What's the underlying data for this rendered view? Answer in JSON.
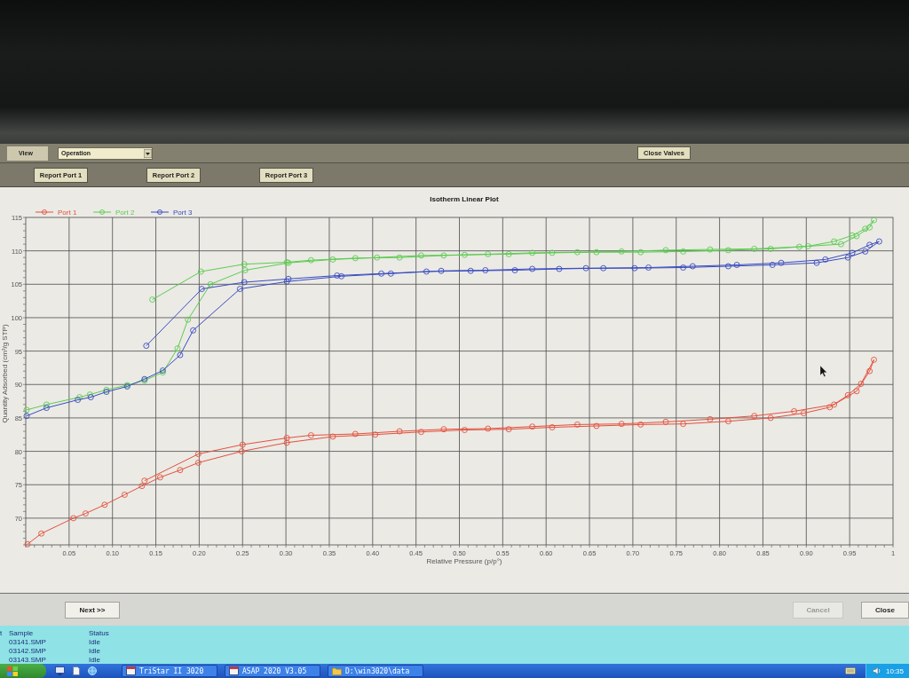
{
  "toolbar": {
    "view_label": "View",
    "view_select": {
      "value": "Operation"
    },
    "close_valves_button": "Close Valves"
  },
  "report_buttons": [
    "Report Port 1",
    "Report Port 2",
    "Report Port 3"
  ],
  "plot": {
    "chart_data": {
      "type": "line",
      "title": "Isotherm Linear Plot",
      "xlabel": "Relative Pressure (p/p°)",
      "ylabel": "Quantity Adsorbed (cm³/g STP)",
      "xlim": [
        0,
        1
      ],
      "ylim": [
        66,
        115
      ],
      "grid": true,
      "legend": "top",
      "xticks": [
        {
          "value": 0.05,
          "label": "0.05"
        },
        {
          "value": 0.1,
          "label": "0.10"
        },
        {
          "value": 0.15,
          "label": "0.15"
        },
        {
          "value": 0.2,
          "label": "0.20"
        },
        {
          "value": 0.25,
          "label": "0.25"
        },
        {
          "value": 0.3,
          "label": "0.30"
        },
        {
          "value": 0.35,
          "label": "0.35"
        },
        {
          "value": 0.4,
          "label": "0.40"
        },
        {
          "value": 0.45,
          "label": "0.45"
        },
        {
          "value": 0.5,
          "label": "0.50"
        },
        {
          "value": 0.55,
          "label": "0.55"
        },
        {
          "value": 0.6,
          "label": "0.60"
        },
        {
          "value": 0.65,
          "label": "0.65"
        },
        {
          "value": 0.7,
          "label": "0.70"
        },
        {
          "value": 0.75,
          "label": "0.75"
        },
        {
          "value": 0.8,
          "label": "0.80"
        },
        {
          "value": 0.85,
          "label": "0.85"
        },
        {
          "value": 0.9,
          "label": "0.90"
        },
        {
          "value": 0.95,
          "label": "0.95"
        },
        {
          "value": 1,
          "label": "1"
        }
      ],
      "yticks": [
        70,
        75,
        80,
        85,
        90,
        95,
        100,
        105,
        110,
        115
      ],
      "series": [
        {
          "name": "Port 1",
          "color": "#e4503c",
          "marker": "circle",
          "x": [
            0.002,
            0.018,
            0.055,
            0.069,
            0.091,
            0.114,
            0.134,
            0.155,
            0.178,
            0.199,
            0.249,
            0.301,
            0.354,
            0.403,
            0.456,
            0.506,
            0.557,
            0.607,
            0.658,
            0.709,
            0.758,
            0.81,
            0.859,
            0.897,
            0.927,
            0.948,
            0.963,
            0.978,
            0.973,
            0.958,
            0.932,
            0.886,
            0.84,
            0.789,
            0.738,
            0.687,
            0.636,
            0.584,
            0.533,
            0.482,
            0.431,
            0.38,
            0.329,
            0.301,
            0.25,
            0.199,
            0.137
          ],
          "values": [
            66.1,
            67.7,
            70.0,
            70.7,
            72.0,
            73.5,
            74.8,
            76.1,
            77.2,
            78.3,
            80.0,
            81.3,
            82.2,
            82.5,
            82.9,
            83.2,
            83.3,
            83.6,
            83.8,
            84.0,
            84.1,
            84.5,
            85.0,
            85.7,
            86.6,
            88.4,
            90.1,
            93.7,
            92.0,
            89.0,
            87.0,
            86.0,
            85.3,
            84.8,
            84.4,
            84.1,
            84.0,
            83.7,
            83.4,
            83.3,
            83.0,
            82.6,
            82.4,
            82.0,
            81.0,
            79.6,
            75.6
          ]
        },
        {
          "name": "Port 2",
          "color": "#5ccc50",
          "marker": "circle",
          "x": [
            0.001,
            0.024,
            0.062,
            0.074,
            0.093,
            0.117,
            0.137,
            0.158,
            0.175,
            0.187,
            0.213,
            0.253,
            0.303,
            0.354,
            0.405,
            0.456,
            0.506,
            0.557,
            0.607,
            0.658,
            0.709,
            0.758,
            0.81,
            0.859,
            0.902,
            0.932,
            0.953,
            0.968,
            0.978,
            0.973,
            0.958,
            0.94,
            0.892,
            0.84,
            0.789,
            0.738,
            0.687,
            0.636,
            0.584,
            0.533,
            0.482,
            0.431,
            0.38,
            0.329,
            0.301,
            0.252,
            0.202,
            0.146
          ],
          "values": [
            86.2,
            87.0,
            88.1,
            88.5,
            89.2,
            89.9,
            90.6,
            91.8,
            95.4,
            99.7,
            105.0,
            107.1,
            108.2,
            108.7,
            109.0,
            109.3,
            109.4,
            109.5,
            109.7,
            109.8,
            109.8,
            109.9,
            110.1,
            110.3,
            110.7,
            111.4,
            112.3,
            113.3,
            114.6,
            113.5,
            112.2,
            111.0,
            110.6,
            110.3,
            110.2,
            110.1,
            109.9,
            109.8,
            109.7,
            109.5,
            109.3,
            109.0,
            108.9,
            108.6,
            108.3,
            108.0,
            106.9,
            102.7
          ]
        },
        {
          "name": "Port 3",
          "color": "#3a4cc0",
          "marker": "circle",
          "x": [
            0.001,
            0.024,
            0.06,
            0.075,
            0.093,
            0.117,
            0.137,
            0.158,
            0.178,
            0.193,
            0.247,
            0.301,
            0.364,
            0.421,
            0.479,
            0.53,
            0.584,
            0.646,
            0.702,
            0.758,
            0.81,
            0.861,
            0.912,
            0.948,
            0.968,
            0.984,
            0.973,
            0.953,
            0.922,
            0.871,
            0.82,
            0.769,
            0.718,
            0.666,
            0.615,
            0.564,
            0.513,
            0.462,
            0.41,
            0.359,
            0.303,
            0.252,
            0.203,
            0.139
          ],
          "values": [
            85.3,
            86.5,
            87.7,
            88.1,
            88.9,
            89.7,
            90.8,
            92.1,
            94.4,
            98.1,
            104.3,
            105.4,
            106.2,
            106.6,
            107.0,
            107.1,
            107.3,
            107.4,
            107.4,
            107.5,
            107.7,
            107.9,
            108.2,
            109.0,
            109.9,
            111.4,
            110.9,
            109.7,
            108.7,
            108.2,
            107.9,
            107.7,
            107.5,
            107.4,
            107.3,
            107.1,
            107.0,
            106.9,
            106.6,
            106.3,
            105.8,
            105.3,
            104.3,
            95.8
          ]
        }
      ]
    }
  },
  "next_button": {
    "label": "Next >>",
    "disabled": false
  },
  "dialog_buttons": [
    {
      "label": "Cancel",
      "disabled": true
    },
    {
      "label": "Close",
      "disabled": false
    }
  ],
  "status_list": {
    "columns": [
      "t",
      "Sample",
      "Status"
    ],
    "rows": [
      {
        "sample": "03141.SMP",
        "status": "Idle"
      },
      {
        "sample": "03142.SMP",
        "status": "Idle"
      },
      {
        "sample": "03143.SMP",
        "status": "Idle"
      }
    ]
  },
  "taskbar": {
    "windows": [
      {
        "label": "TriStar II 3020",
        "kind": "app"
      },
      {
        "label": "ASAP 2020 V3.05",
        "kind": "app"
      },
      {
        "label": "D:\\win3020\\data",
        "kind": "folder"
      }
    ],
    "clock": "10:35"
  }
}
